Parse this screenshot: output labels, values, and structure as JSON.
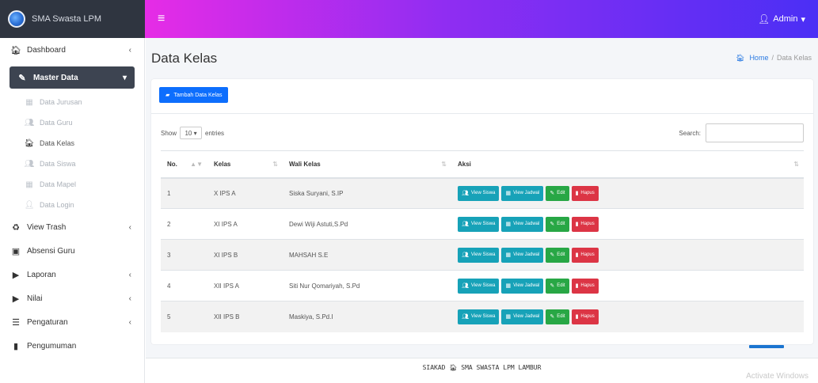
{
  "brand": {
    "title": "SMA Swasta LPM"
  },
  "navbar": {
    "user": "Admin"
  },
  "sidebar": {
    "items": [
      {
        "label": "Dashboard",
        "icon": "home-icon",
        "glyph": "🏠︎",
        "chevron": true
      },
      {
        "label": "Master Data",
        "icon": "edit-icon",
        "glyph": "✎",
        "chevron": true,
        "active": true
      }
    ],
    "sub_items": [
      {
        "label": "Data Jurusan",
        "glyph": "▦"
      },
      {
        "label": "Data Guru",
        "glyph": "👥︎"
      },
      {
        "label": "Data Kelas",
        "glyph": "🏠︎",
        "current": true
      },
      {
        "label": "Data Siswa",
        "glyph": "👥︎"
      },
      {
        "label": "Data Mapel",
        "glyph": "▦"
      },
      {
        "label": "Data Login",
        "glyph": "👤︎"
      }
    ],
    "items_after": [
      {
        "label": "View Trash",
        "glyph": "♻",
        "chevron": true
      },
      {
        "label": "Absensi Guru",
        "glyph": "▣",
        "chevron": false
      },
      {
        "label": "Laporan",
        "glyph": "▶",
        "chevron": true
      },
      {
        "label": "Nilai",
        "glyph": "▶",
        "chevron": true
      },
      {
        "label": "Pengaturan",
        "glyph": "☰",
        "chevron": true
      },
      {
        "label": "Pengumuman",
        "glyph": "▮",
        "chevron": false
      }
    ]
  },
  "page": {
    "title": "Data Kelas"
  },
  "breadcrumb": {
    "home": "Home",
    "separator": "/",
    "current": "Data Kelas"
  },
  "card": {
    "add_button": "Tambah Data Kelas"
  },
  "datatable": {
    "show_label": "Show",
    "show_value": "10",
    "entries_label": "entries",
    "search_label": "Search:"
  },
  "table": {
    "headers": [
      "No.",
      "Kelas",
      "Wali Kelas",
      "Aksi"
    ],
    "rows": [
      {
        "no": "1",
        "kelas": "X IPS A",
        "wali": "Siska Suryani, S.IP"
      },
      {
        "no": "2",
        "kelas": "XI IPS A",
        "wali": "Dewi Wiji Astuti,S.Pd"
      },
      {
        "no": "3",
        "kelas": "XI IPS B",
        "wali": "MAHSAH S.E"
      },
      {
        "no": "4",
        "kelas": "XII IPS A",
        "wali": "Siti Nur Qomariyah, S.Pd"
      },
      {
        "no": "5",
        "kelas": "XII IPS B",
        "wali": "Maskiya, S.Pd.I"
      }
    ],
    "actions": {
      "view_siswa": "View Siswa",
      "view_jadwal": "View Jadwal",
      "edit": "Edit",
      "hapus": "Hapus"
    }
  },
  "footer": {
    "text": "SIAKAD 🏠︎ SMA SWASTA LPM LAMBUR"
  },
  "watermark": "Activate Windows",
  "colors": {
    "primary": "#0d6efd",
    "info": "#17a2b8",
    "success": "#28a745",
    "danger": "#dc3545",
    "sidebar_active": "#3d4451"
  }
}
